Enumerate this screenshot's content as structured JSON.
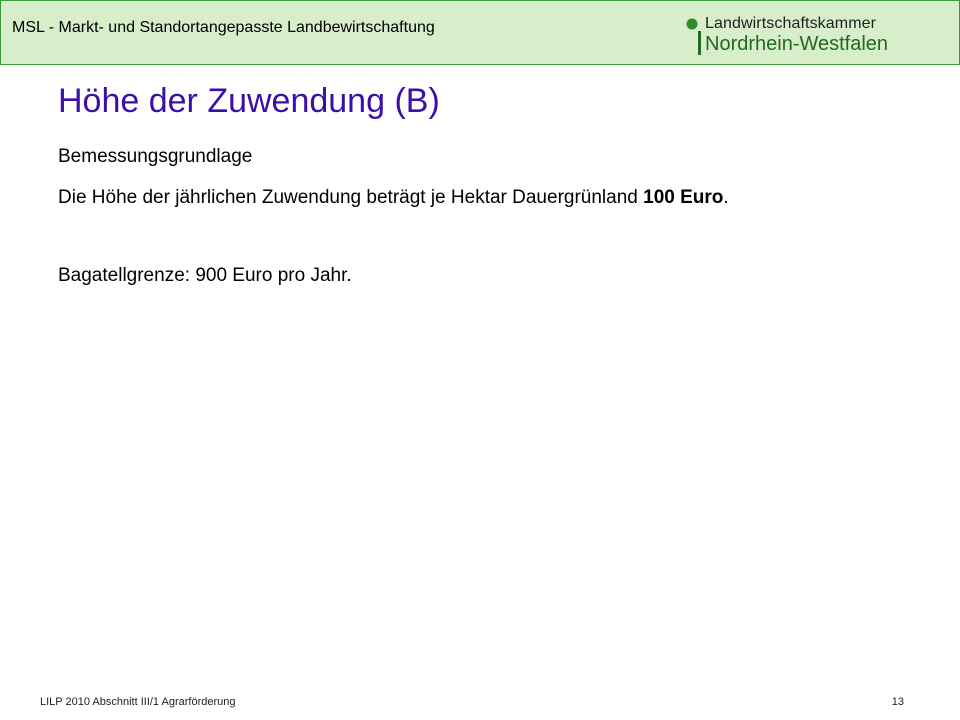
{
  "header": {
    "title": "MSL - Markt- und Standortangepasste Landbewirtschaftung",
    "logo": {
      "line1": "Landwirtschaftskammer",
      "line2": "Nordrhein-Westfalen",
      "mark_color": "#2e8b2e"
    }
  },
  "slide": {
    "title": "Höhe der Zuwendung (B)",
    "subheading": "Bemessungsgrundlage",
    "amount_line": {
      "prefix": "Die Höhe der jährlichen Zuwendung beträgt je Hektar Dauergrünland ",
      "value": "100 Euro",
      "suffix": "."
    },
    "bagatell": "Bagatellgrenze: 900 Euro pro Jahr."
  },
  "footer": {
    "left": "LILP 2010 Abschnitt III/1 Agrarförderung",
    "page_number": "13"
  },
  "colors": {
    "header_background": "#d8edca",
    "header_border": "#3a9a3a",
    "title": "#3b0fa8"
  }
}
